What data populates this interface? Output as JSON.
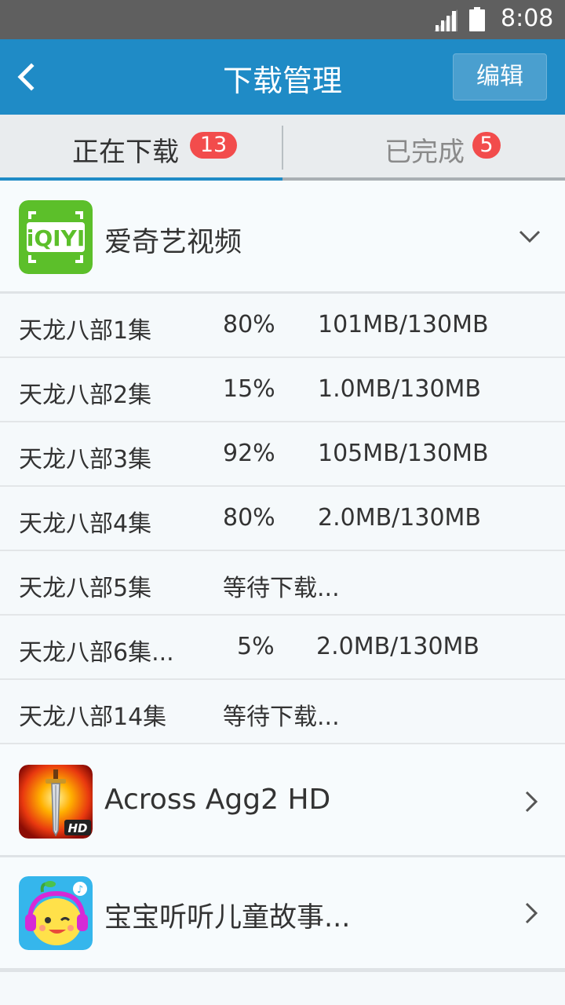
{
  "status_bar": {
    "time": "8:08"
  },
  "header": {
    "title": "下载管理",
    "edit_label": "编辑"
  },
  "tabs": [
    {
      "label": "正在下载",
      "badge": "13",
      "active": true
    },
    {
      "label": "已完成",
      "badge": "5",
      "active": false
    }
  ],
  "groups": [
    {
      "name": "爱奇艺视频",
      "icon": "iqiyi-app-icon",
      "expanded": true,
      "tasks": [
        {
          "episode": "天龙八部1集",
          "progress": "80%",
          "size": "101MB/130MB"
        },
        {
          "episode": "天龙八部2集",
          "progress": "15%",
          "size": "1.0MB/130MB"
        },
        {
          "episode": "天龙八部3集",
          "progress": "92%",
          "size": "105MB/130MB"
        },
        {
          "episode": "天龙八部4集",
          "progress": "80%",
          "size": "2.0MB/130MB"
        },
        {
          "episode": "天龙八部5集",
          "progress": "等待下载...",
          "size": ""
        },
        {
          "episode": "天龙八部6集...",
          "progress": "5%",
          "size": "2.0MB/130MB"
        },
        {
          "episode": "天龙八部14集",
          "progress": "等待下载...",
          "size": ""
        }
      ]
    },
    {
      "name": "Across Agg2 HD",
      "icon": "sword-game-app-icon",
      "expanded": false
    },
    {
      "name": "宝宝听听儿童故事...",
      "icon": "kids-story-app-icon",
      "expanded": false
    }
  ],
  "colors": {
    "header": "#1f8bc6",
    "status_bar": "#5f5f5f",
    "badge": "#f24c4c",
    "iqiyi_green": "#5cbf2a"
  }
}
